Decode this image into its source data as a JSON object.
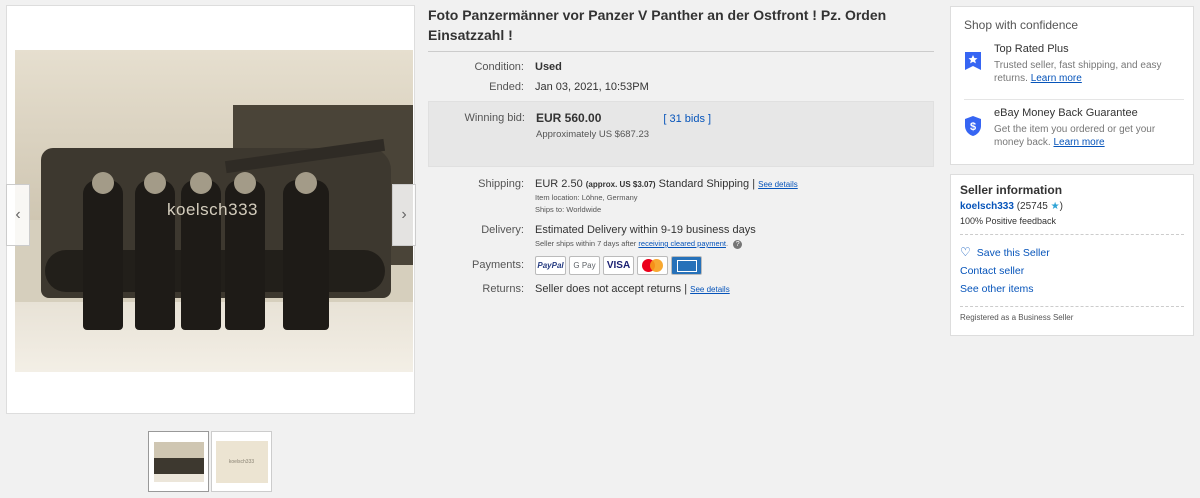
{
  "listing": {
    "title": "Foto Panzermänner vor Panzer V Panther an der Ostfront ! Pz. Orden Einsatzzahl !",
    "watermark": "koelsch333",
    "thumb2_text": "koelsch333",
    "condition_label": "Condition:",
    "condition_value": "Used",
    "ended_label": "Ended:",
    "ended_value": "Jan 03, 2021, 10:53PM",
    "winning_bid_label": "Winning bid:",
    "winning_bid_value": "EUR 560.00",
    "approx_value": "Approximately US $687.23",
    "bids_link": "[ 31 bids ]",
    "shipping_label": "Shipping:",
    "shipping_price": "EUR 2.50",
    "shipping_approx": "(approx. US $3.07)",
    "shipping_service": "Standard Shipping |",
    "shipping_details_link": "See details",
    "item_location": "Item location:  Löhne, Germany",
    "ships_to": "Ships to:  Worldwide",
    "delivery_label": "Delivery:",
    "delivery_value": "Estimated Delivery within 9-19 business days",
    "delivery_note_prefix": "Seller ships within 7 days after",
    "delivery_note_link": "receiving cleared payment",
    "delivery_note_suffix": ".",
    "payments_label": "Payments:",
    "returns_label": "Returns:",
    "returns_value": "Seller does not accept returns |",
    "returns_details_link": "See details"
  },
  "payments": {
    "paypal": "PayPal",
    "gpay": "G Pay",
    "visa": "VISA"
  },
  "confidence": {
    "heading": "Shop with confidence",
    "top_rated_title": "Top Rated Plus",
    "top_rated_desc": "Trusted seller, fast shipping, and easy returns.",
    "top_rated_link": "Learn more",
    "mbg_title": "eBay Money Back Guarantee",
    "mbg_desc": "Get the item you ordered or get your money back.",
    "mbg_link": "Learn more"
  },
  "seller": {
    "heading": "Seller information",
    "username": "koelsch333",
    "score": "(25745",
    "star": "★",
    "score_close": ")",
    "feedback": "100% Positive feedback",
    "save_seller": "Save this Seller",
    "contact": "Contact seller",
    "other_items": "See other items",
    "registered": "Registered as a Business Seller"
  },
  "colors": {
    "link": "#0654ba",
    "star": "#2ea3d6",
    "shield": "#3665f3"
  },
  "icons": {
    "prev": "chevron-left-icon",
    "next": "chevron-right-icon",
    "top_rated": "badge-icon",
    "mbg": "shield-icon",
    "save": "heart-icon",
    "help": "question-icon"
  }
}
